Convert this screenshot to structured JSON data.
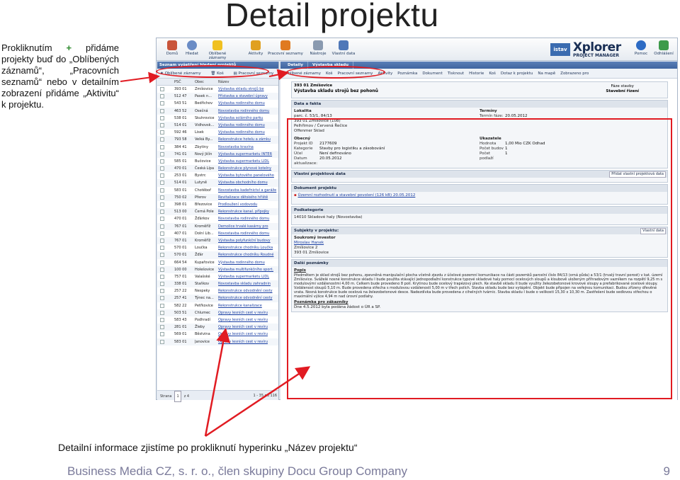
{
  "slide": {
    "title": "Detail projektu",
    "left_note_1": "Prokliknutím ",
    "left_note_plus": "+",
    "left_note_2": " přidáme projekty buď do „Oblíbených záznamů“, „Pracovních seznamů“ nebo v detailním zobrazení přidáme „Aktivitu“ k projektu.",
    "caption": "Detailní informace zjistíme po prokliknutí hyperinku „Název projektu“",
    "footer": "Business Media CZ, s. r. o., člen skupiny Docu Group Company",
    "page_number": "9"
  },
  "toolbar": {
    "buttons": [
      "Domů",
      "Hledat",
      "Oblíbené záznamy",
      "Aktivity",
      "Pracovní seznamy",
      "Nástroje",
      "Vlastní data"
    ],
    "right_buttons": [
      "Pomoc",
      "Odhlášení"
    ],
    "brand_small": "istav",
    "brand": "Xplorer",
    "brand_sub": "PROJECT MANAGER"
  },
  "list_panel": {
    "header": "Seznam vyšetření hledaní projektů",
    "tools": [
      "Oblíbené záznamy",
      "Koš",
      "Pracovní seznamy"
    ],
    "columns": [
      "PSČ",
      "Obec",
      "Název"
    ],
    "rows": [
      {
        "psc": "393 01",
        "obec": "Zmíšovice",
        "nazev": "Výstavba skladu strojů be"
      },
      {
        "psc": "512 47",
        "obec": "Pasek n...",
        "nazev": "Přístavba a stavební úpravy"
      },
      {
        "psc": "543 51",
        "obec": "Bedřichov",
        "nazev": "Výstavba rodinného domu"
      },
      {
        "psc": "463 52",
        "obec": "Osečná",
        "nazev": "Novostavba rodinného domu"
      },
      {
        "psc": "538 01",
        "obec": "Skuhrovice",
        "nazev": "Výstavba solárního parku"
      },
      {
        "psc": "514 01",
        "obec": "Vidhovsk...",
        "nazev": "Výstavba rodinného domu"
      },
      {
        "psc": "592 46",
        "obec": "Lisek",
        "nazev": "Výstavba rodinného domu"
      },
      {
        "psc": "793 58",
        "obec": "Velká By...",
        "nazev": "Rekonstrukce hotelu a zámku"
      },
      {
        "psc": "384 41",
        "obec": "Zbytiny",
        "nazev": "Novostavba kravína"
      },
      {
        "psc": "741 01",
        "obec": "Nový Jičín",
        "nazev": "Výstavba supermarketu INTER"
      },
      {
        "psc": "585 01",
        "obec": "Bučovice",
        "nazev": "Výstavba supermarketu LIDL"
      },
      {
        "psc": "470 01",
        "obec": "Česká Lípa",
        "nazev": "Rekonstrukce plynové kotelny"
      },
      {
        "psc": "253 01",
        "obec": "Bystrc",
        "nazev": "Výstavba bytového panelového"
      },
      {
        "psc": "514 01",
        "obec": "Lutyně",
        "nazev": "Výstavba obchodního domu"
      },
      {
        "psc": "583 01",
        "obec": "Chotěboř",
        "nazev": "Novostavba kadeřnictví a garáže"
      },
      {
        "psc": "750 02",
        "obec": "Přerov",
        "nazev": "Revitalizace dětského hřiště"
      },
      {
        "psc": "398 01",
        "obec": "Březovice",
        "nazev": "Prodloužení vodovodu"
      },
      {
        "psc": "513 00",
        "obec": "Černá Pole",
        "nazev": "Rekonstrukce kanal. přípojky"
      },
      {
        "psc": "470 01",
        "obec": "Žďárkov",
        "nazev": "Novostavba rodinného domu"
      },
      {
        "psc": "767 01",
        "obec": "Kroměříž",
        "nazev": "Demolice trvalé kasárny pro"
      },
      {
        "psc": "407 01",
        "obec": "Dolní Lib...",
        "nazev": "Novostavba rodinného domu"
      },
      {
        "psc": "767 01",
        "obec": "Kroměříž",
        "nazev": "Výstavba polyfunkční budovy"
      },
      {
        "psc": "570 01",
        "obec": "Loučka",
        "nazev": "Rekonstrukce chodníku Loučka"
      },
      {
        "psc": "570 01",
        "obec": "Žďár",
        "nazev": "Rekonstrukce chodníku Roudné"
      },
      {
        "psc": "664 54",
        "obec": "Kupařovice",
        "nazev": "Výstavba rodinného domu"
      },
      {
        "psc": "100 00",
        "obec": "Holešovice",
        "nazev": "Výstavba multifunkčního sport."
      },
      {
        "psc": "757 01",
        "obec": "Valašské",
        "nazev": "Výstavba supermarketu LIDL"
      },
      {
        "psc": "338 01",
        "obec": "Staňkov",
        "nazev": "Novostavba skladu zahradnin"
      },
      {
        "psc": "257 22",
        "obec": "Nespeky",
        "nazev": "Rekonstrukce odvodnění cesty"
      },
      {
        "psc": "257 41",
        "obec": "Týnec na...",
        "nazev": "Rekonstrukce odvodnění cesty"
      },
      {
        "psc": "582 22",
        "obec": "Petřkovice",
        "nazev": "Rekonstrukce kanalizace"
      },
      {
        "psc": "503 51",
        "obec": "Chlumec",
        "nazev": "Opravy lesních cest v revíru"
      },
      {
        "psc": "583 43",
        "obec": "Podhradí",
        "nazev": "Opravy lesních cest v revíru"
      },
      {
        "psc": "281 01",
        "obec": "Žleby",
        "nazev": "Opravy lesních cest v revíru"
      },
      {
        "psc": "569 01",
        "obec": "Běstvina",
        "nazev": "Opravy lesních cest v revíru"
      },
      {
        "psc": "583 01",
        "obec": "Janovice",
        "nazev": "Opravy lesních cest v revíru"
      }
    ],
    "footer_page": "Strana",
    "footer_page_num": "1",
    "footer_of": "z 4",
    "footer_count": "1 - 35 od 116"
  },
  "detail": {
    "tab_label": "Výstavba skladu",
    "tab_details": "Detaily",
    "tools": [
      "Oblíbené záznamy",
      "Koš",
      "Pracovní seznamy",
      "Aktivity",
      "Poznámka",
      "Dokument",
      "Tisknout",
      "Historie",
      "Koš",
      "Dotaz k projektu",
      "Na mapě",
      "Zobrazeno pro"
    ],
    "head_line1": "393 01 Zmíšovice",
    "head_line2": "Výstavba skladu strojů bez pohonů",
    "head_stage_label": "Fáze stavby",
    "head_stage_value": "Stavební řízení",
    "data_header": "Data a fakta",
    "lokalita_label": "Lokalita",
    "lokalita_lines": [
      "parc. č. 53/1, 84/13",
      "393 01 Zmíšovice (108)",
      "Pelhřimov / Červená Řečice",
      "Offenmer Sklad"
    ],
    "termin_label": "Termíny",
    "termin_key": "Termín fáze:",
    "termin_value": "20.05.2012",
    "obecny_label": "Obecný",
    "obecny": [
      {
        "k": "Projekt ID",
        "v": "2177609"
      },
      {
        "k": "Kategorie",
        "v": "Stavby pro logistiku a zásobování"
      },
      {
        "k": "Účel",
        "v": "Není definováno"
      },
      {
        "k": "Datum aktualizace:",
        "v": "20.05.2012"
      }
    ],
    "ukazatele_label": "Ukazatele",
    "ukazatele": [
      {
        "k": "Hodnota",
        "v": "1,00 Mio CZK Odhad"
      },
      {
        "k": "Počet budov",
        "v": "1"
      },
      {
        "k": "Počet podlaží",
        "v": "1"
      }
    ],
    "own_data_header": "Vlastní projektová data",
    "own_data_action": "Přidat vlastní projektová data",
    "doc_header": "Dokument projektu",
    "doc_link": "Územní rozhodnutí a stavební povolení (126 kB) 20.05.2012",
    "podkat_header": "Podkategorie",
    "podkat_value": "14010 Skladové haly (Novostavba)",
    "subj_header": "Subjekty v projektu:",
    "subj_action": "Vlastní data",
    "subj_role": "Soukromý investor",
    "subj_name": "Miroslav Hanek",
    "subj_addr1": "Zmíšovice 2",
    "subj_addr2": "393 01 Zmíšovice",
    "notes_header": "Další poznámky",
    "notes_popis": "Popis",
    "notes_text": "Předmětem je sklad strojů bez pohonu, zpevněná manipulační plocha včetně zjezdu z účelové pozemní komunikace na části pozemků parcelní číslo 84/13 (orná půda) a 53/1 (trvalý travní porost) v kat. území Zmíšovice. Sváželé nosné konstrukce skladu I bude použita stávající jednopodlažní konstrukce typové skladové haly pomocí ocelových sloupů a kloubově uloženým příhradovým vazníkem na rozpětí 9,25 m s modulovými vzdálenostmi 4,00 m. Celkem bude provedeno 8 polí. Krytinou bude ocelový trapézový plech. Ke stavbě skladu II bude využity železobetonové krovové sloupy a prefabrikované ocelové sloupy. Vzdálenost sloupů 5,10 m. Bude provedena střecha s modulovou vzdáleností 5,00 m v třech polích. Stavba skladu bude bez vytápění. Objekt bude připojen na veřejnou komunikaci. Budou zřízeny dřevěné vrata. Nosná konstrukce bude ocelová na železobetonové desce. Nadezdívka bude provedena z cihelných tvárnic. Stavba skladu I bude o velikosti 15,30 x 10,30 m. Zastřešení bude sedlovou střechou o maximální výšce 4,94 m nad úrovní podlahy.",
    "notes_extra_label": "Poznámka pro zákazníky",
    "notes_extra_value": "Dne 4.5.2012 byla podána žádost o ÚR a SP."
  }
}
